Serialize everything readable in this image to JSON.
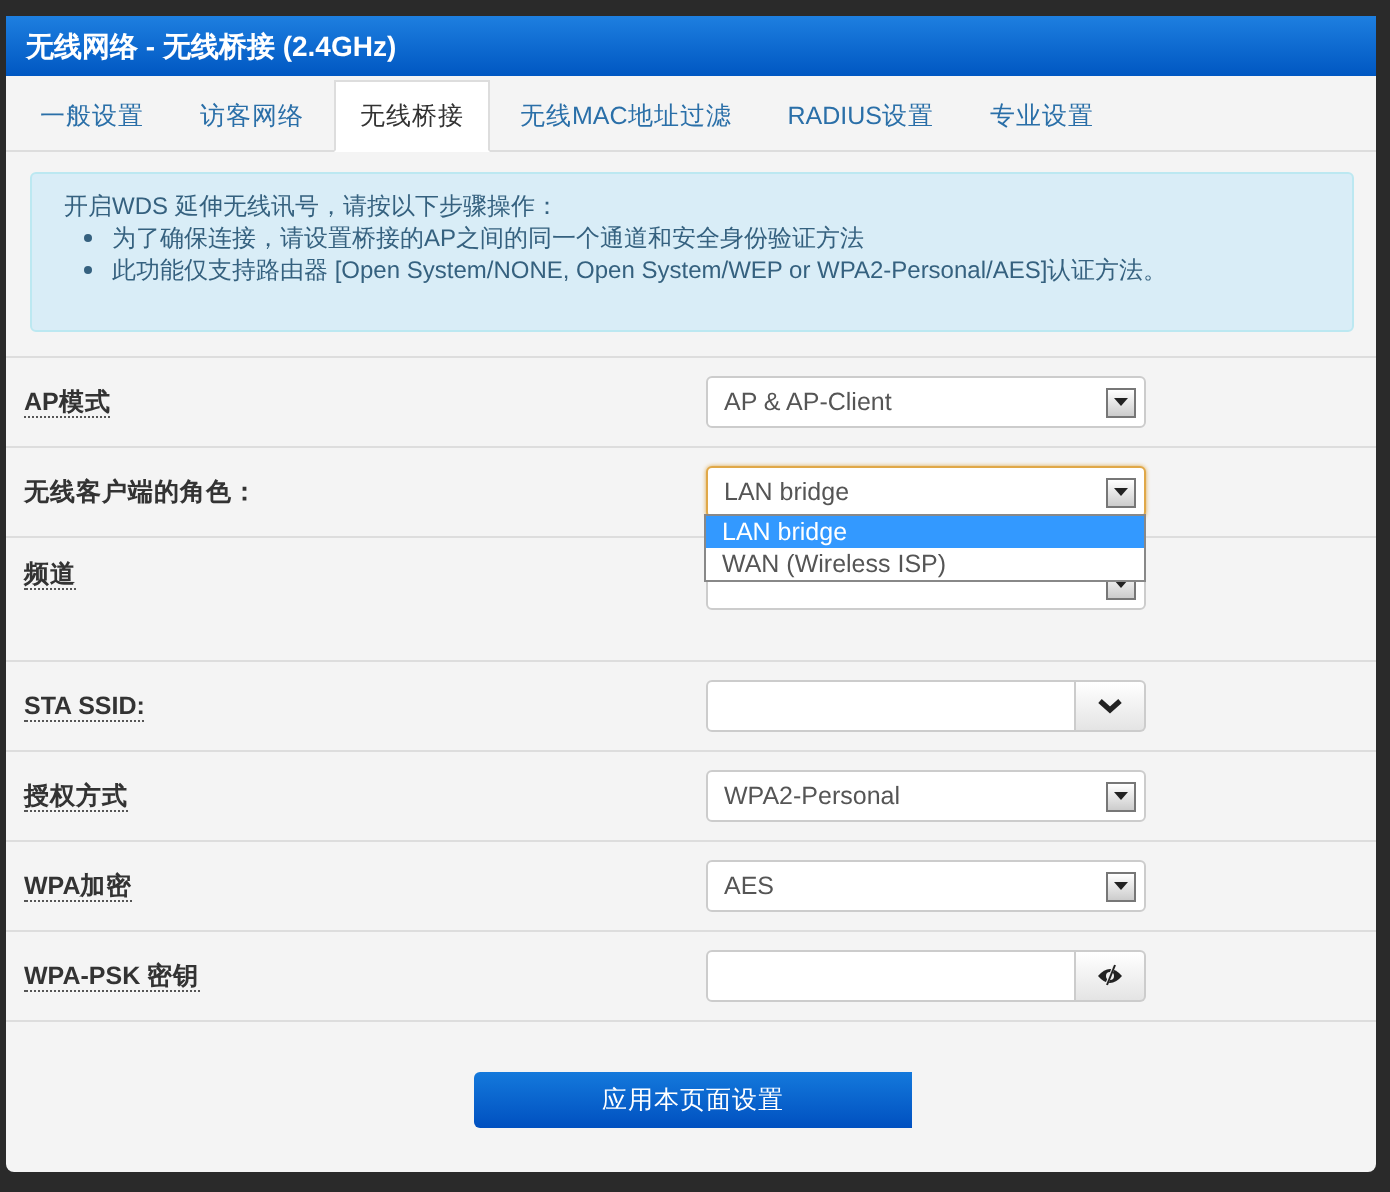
{
  "window": {
    "title": "无线网络 - 无线桥接 (2.4GHz)"
  },
  "tabs": [
    {
      "label": "一般设置",
      "selected": false
    },
    {
      "label": "访客网络",
      "selected": false
    },
    {
      "label": "无线桥接",
      "selected": true
    },
    {
      "label": "无线MAC地址过滤",
      "selected": false
    },
    {
      "label": "RADIUS设置",
      "selected": false
    },
    {
      "label": "专业设置",
      "selected": false
    }
  ],
  "info": {
    "intro": "开启WDS 延伸无线讯号，请按以下步骤操作：",
    "bullets": [
      "为了确保连接，请设置桥接的AP之间的同一个通道和安全身份验证方法",
      "此功能仅支持路由器 [Open System/NONE, Open System/WEP or WPA2-Personal/AES]认证方法。"
    ]
  },
  "fields": [
    {
      "label": "AP模式",
      "kind": "select",
      "value": "AP & AP-Client"
    },
    {
      "label": "无线客户端的角色：",
      "kind": "select",
      "value": "LAN bridge",
      "focused": true,
      "options": [
        {
          "label": "LAN bridge",
          "selected": true
        },
        {
          "label": "WAN (Wireless ISP)",
          "selected": false
        }
      ]
    },
    {
      "label": "频道",
      "kind": "select"
    },
    {
      "label": "STA SSID:",
      "kind": "combo"
    },
    {
      "label": "授权方式",
      "kind": "select",
      "value": "WPA2-Personal"
    },
    {
      "label": "WPA加密",
      "kind": "select",
      "value": "AES"
    },
    {
      "label": "WPA-PSK 密钥",
      "kind": "password"
    }
  ],
  "apply_button": "应用本页面设置"
}
